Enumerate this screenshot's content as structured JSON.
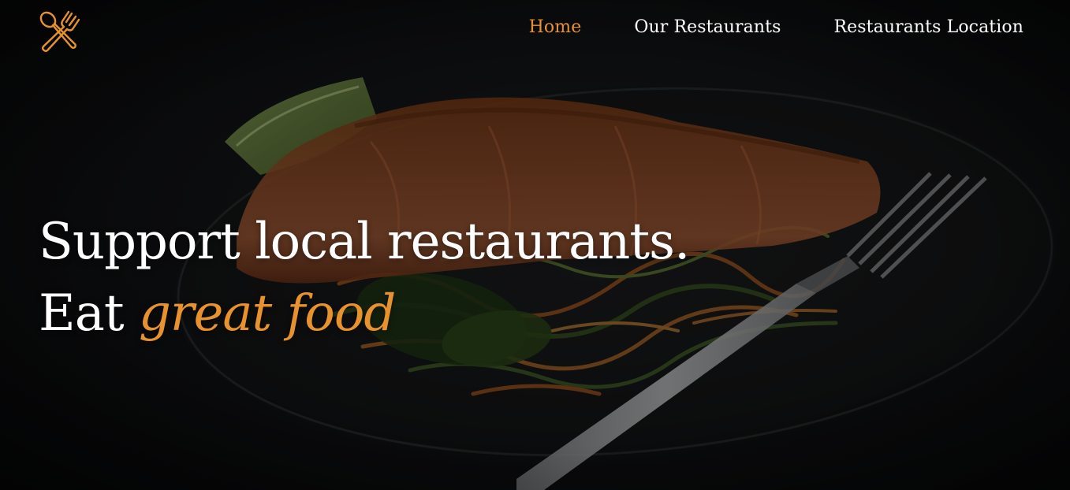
{
  "nav": {
    "logo_icon": "spoon-fork-cross-icon",
    "links": [
      {
        "label": "Home",
        "active": true
      },
      {
        "label": "Our Restaurants",
        "active": false
      },
      {
        "label": "Restaurants Location",
        "active": false
      }
    ]
  },
  "hero": {
    "line1": "Support local restaurants.",
    "line2_prefix": "Eat ",
    "line2_accent": "great food",
    "background_image": "grilled-salmon-plate-photo"
  },
  "colors": {
    "accent": "#e8922e",
    "text": "#ffffff",
    "background": "#0d0e10"
  }
}
